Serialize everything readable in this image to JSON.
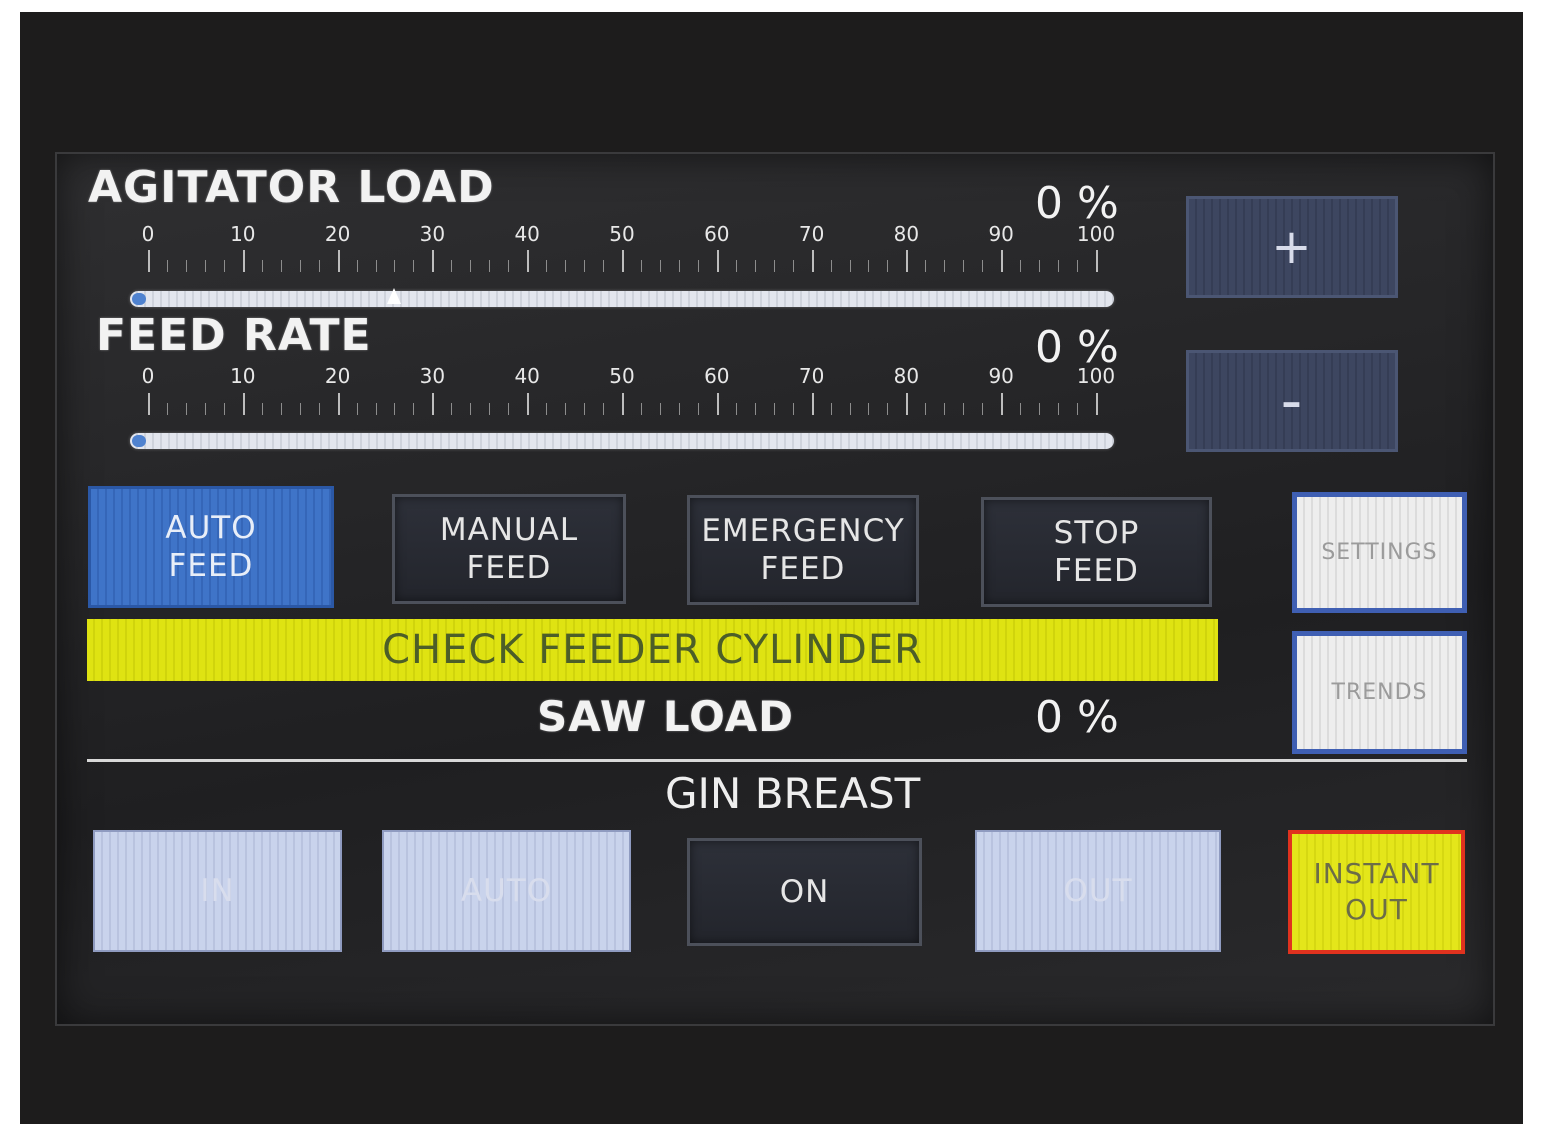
{
  "agitator": {
    "title": "AGITATOR LOAD",
    "percent": "0 %",
    "scale_labels": [
      "0",
      "10",
      "20",
      "30",
      "40",
      "50",
      "60",
      "70",
      "80",
      "90",
      "100"
    ],
    "value_pct": 0,
    "setpoint_pct": 26
  },
  "feed_rate": {
    "title": "FEED RATE",
    "percent": "0 %",
    "scale_labels": [
      "0",
      "10",
      "20",
      "30",
      "40",
      "50",
      "60",
      "70",
      "80",
      "90",
      "100"
    ],
    "value_pct": 0
  },
  "adjust": {
    "plus_label": "+",
    "minus_label": "-"
  },
  "modes": {
    "auto_feed": "AUTO\nFEED",
    "manual_feed": "MANUAL\nFEED",
    "emergency_feed": "EMERGENCY\nFEED",
    "stop_feed": "STOP\nFEED"
  },
  "side": {
    "settings": "SETTINGS",
    "trends": "TRENDS",
    "instant_out": "INSTANT\nOUT"
  },
  "alarm": {
    "message": "CHECK FEEDER CYLINDER"
  },
  "saw_load": {
    "title": "SAW LOAD",
    "percent": "0 %"
  },
  "gin_breast": {
    "title": "GIN BREAST",
    "in": "IN",
    "auto": "AUTO",
    "on": "ON",
    "out": "OUT"
  },
  "colors": {
    "accent_blue": "#3f74c8",
    "alarm_yellow": "#dfe312",
    "instant_out_border": "#e0321e"
  }
}
